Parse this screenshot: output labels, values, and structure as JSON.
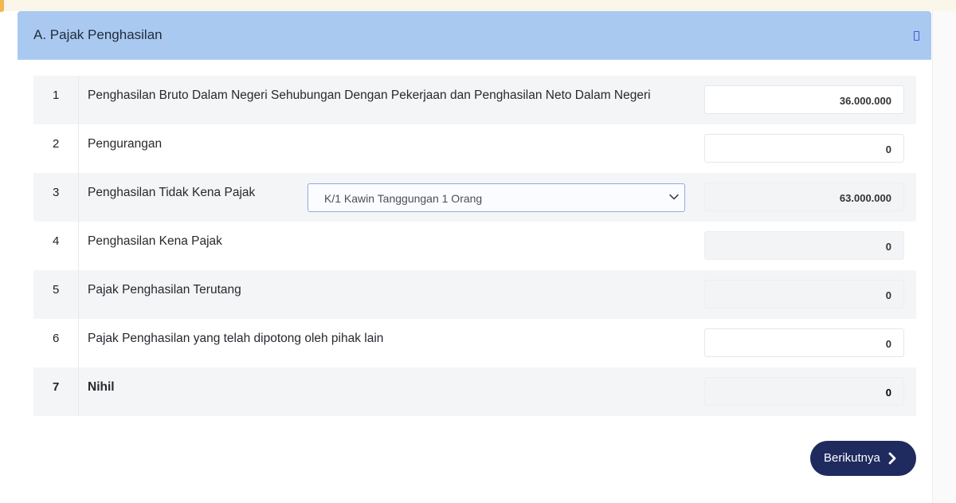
{
  "section": {
    "title": "A. Pajak Penghasilan",
    "collapse_icon": "collapse-icon"
  },
  "rows": [
    {
      "no": "1",
      "label": "Penghasilan Bruto Dalam Negeri Sehubungan Dengan Pekerjaan dan Penghasilan Neto Dalam Negeri",
      "value": "36.000.000"
    },
    {
      "no": "2",
      "label": "Pengurangan",
      "value": "0"
    },
    {
      "no": "3",
      "label": "Penghasilan Tidak Kena Pajak",
      "value": "63.000.000"
    },
    {
      "no": "4",
      "label": "Penghasilan Kena Pajak",
      "value": "0"
    },
    {
      "no": "5",
      "label": "Pajak Penghasilan Terutang",
      "value": "0"
    },
    {
      "no": "6",
      "label": "Pajak Penghasilan yang telah dipotong oleh pihak lain",
      "value": "0"
    },
    {
      "no": "7",
      "label": "Nihil",
      "value": "0"
    }
  ],
  "ptkp_select": {
    "selected": "K/1 Kawin Tanggungan 1 Orang",
    "icon": "chevron-down-icon"
  },
  "footer": {
    "next_label": "Berikutnya",
    "next_icon": "chevron-right-icon"
  },
  "colors": {
    "header_bg": "#aac9f0",
    "button_bg": "#1f2b5e",
    "select_border": "#97a8e6"
  }
}
